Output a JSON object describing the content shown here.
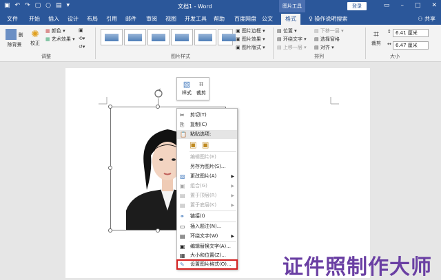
{
  "titlebar": {
    "doc_title": "文档1 - Word",
    "picture_tools": "图片工具",
    "login": "登录"
  },
  "tabs": [
    "文件",
    "开始",
    "插入",
    "设计",
    "布局",
    "引用",
    "邮件",
    "审阅",
    "视图",
    "开发工具",
    "帮助",
    "百度网盘",
    "公文",
    "格式",
    "操作说明搜索"
  ],
  "share": "共享",
  "ribbon": {
    "remove_bg": "删除背景",
    "correct": "校正",
    "color": "颜色",
    "art_effects": "艺术效果",
    "group_adjust": "调整",
    "picture_border": "图片边框",
    "picture_effects": "图片效果",
    "picture_layout": "图片版式",
    "group_styles": "图片样式",
    "position": "位置",
    "wrap_text": "环绕文字",
    "bring_forward": "上移一层",
    "send_backward": "下移一层",
    "selection_pane": "选择窗格",
    "align": "对齐",
    "group_arrange": "排列",
    "crop": "裁剪",
    "height": "6.41 厘米",
    "width": "6.47 厘米",
    "group_size": "大小"
  },
  "mini_toolbar": {
    "style": "样式",
    "crop": "裁剪"
  },
  "context_menu": [
    {
      "label": "剪切(T)",
      "disabled": false
    },
    {
      "label": "复制(C)",
      "disabled": false
    },
    {
      "label": "粘贴选项:",
      "disabled": false
    },
    {
      "label": "编辑图片(E)",
      "disabled": true
    },
    {
      "label": "另存为图片(S)...",
      "disabled": false
    },
    {
      "label": "更改图片(A)",
      "disabled": false
    },
    {
      "label": "组合(G)",
      "disabled": true
    },
    {
      "label": "置于顶层(R)",
      "disabled": true
    },
    {
      "label": "置于底层(K)",
      "disabled": true
    },
    {
      "label": "链接(I)",
      "disabled": false
    },
    {
      "label": "插入题注(N)...",
      "disabled": false
    },
    {
      "label": "环绕文字(W)",
      "disabled": false
    },
    {
      "label": "编辑替换文字(A)...",
      "disabled": false
    },
    {
      "label": "大小和位置(Z)...",
      "disabled": false
    },
    {
      "label": "设置图片格式(O)...",
      "disabled": false
    }
  ],
  "watermark": "证件照制作大师",
  "colors": {
    "accent": "#2b579a",
    "highlight_box": "#d42020",
    "watermark": "#6a3fa3"
  }
}
